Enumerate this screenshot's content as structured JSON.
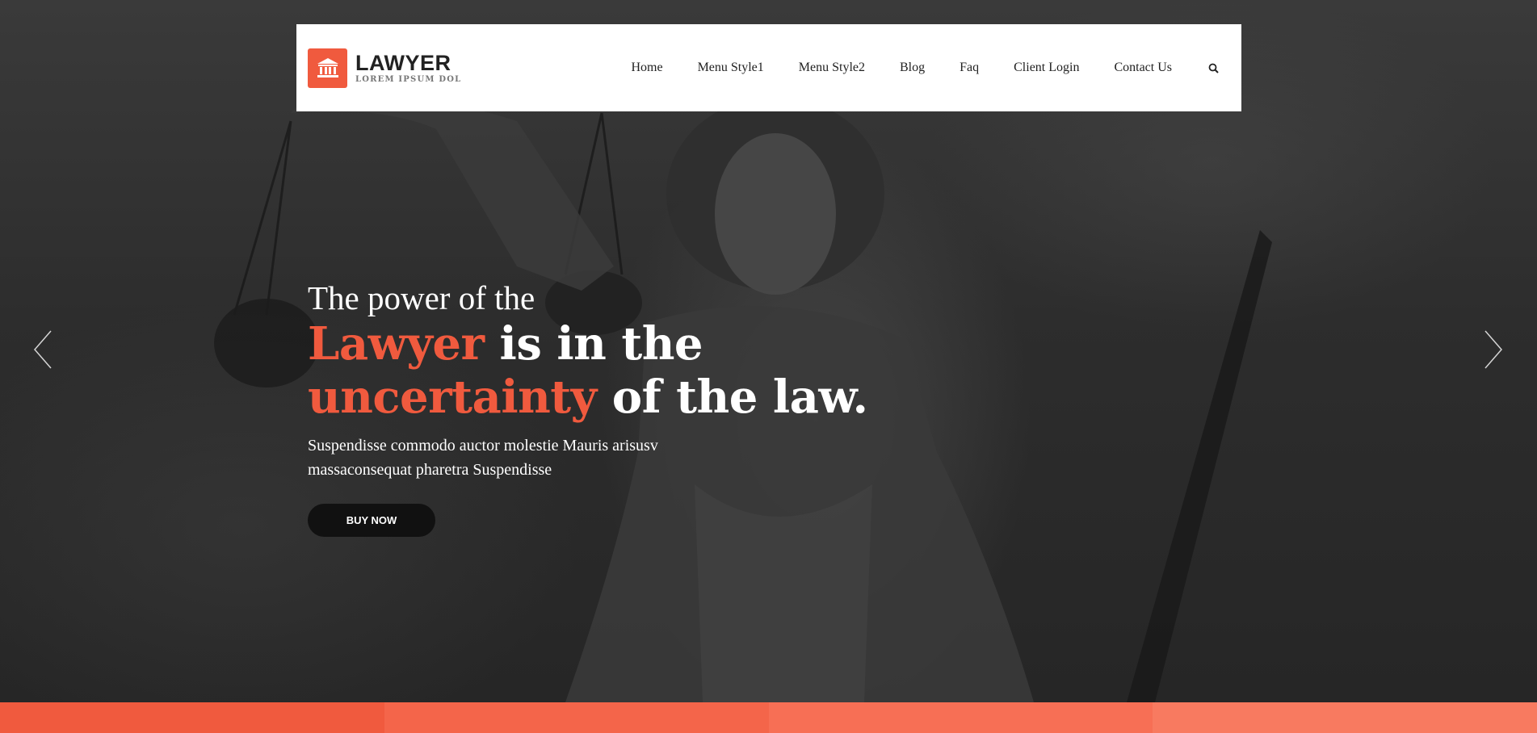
{
  "header": {
    "logo": {
      "title": "LAWYER",
      "subtitle": "LOREM IPSUM DOL",
      "icon": "courthouse-icon",
      "color": "#f05a3e"
    },
    "nav": [
      {
        "label": "Home"
      },
      {
        "label": "Menu Style1"
      },
      {
        "label": "Menu Style2"
      },
      {
        "label": "Blog"
      },
      {
        "label": "Faq"
      },
      {
        "label": "Client Login"
      },
      {
        "label": "Contact Us"
      }
    ],
    "search_icon": "search-icon"
  },
  "hero": {
    "line1": "The power of the",
    "line2_accent": "Lawyer",
    "line2_rest": " is in the",
    "line3_accent": "uncertainty",
    "line3_rest": " of the law.",
    "description_line1": "Suspendisse commodo auctor molestie Mauris arisusv",
    "description_line2": "massaconsequat pharetra Suspendisse",
    "button_label": "BUY NOW",
    "accent_color": "#f05a3e"
  },
  "slider": {
    "prev_icon": "chevron-left-icon",
    "next_icon": "chevron-right-icon"
  },
  "strips": {
    "colors": [
      "#f05a3e",
      "#f4654a",
      "#f76f55",
      "#f87a60"
    ]
  }
}
